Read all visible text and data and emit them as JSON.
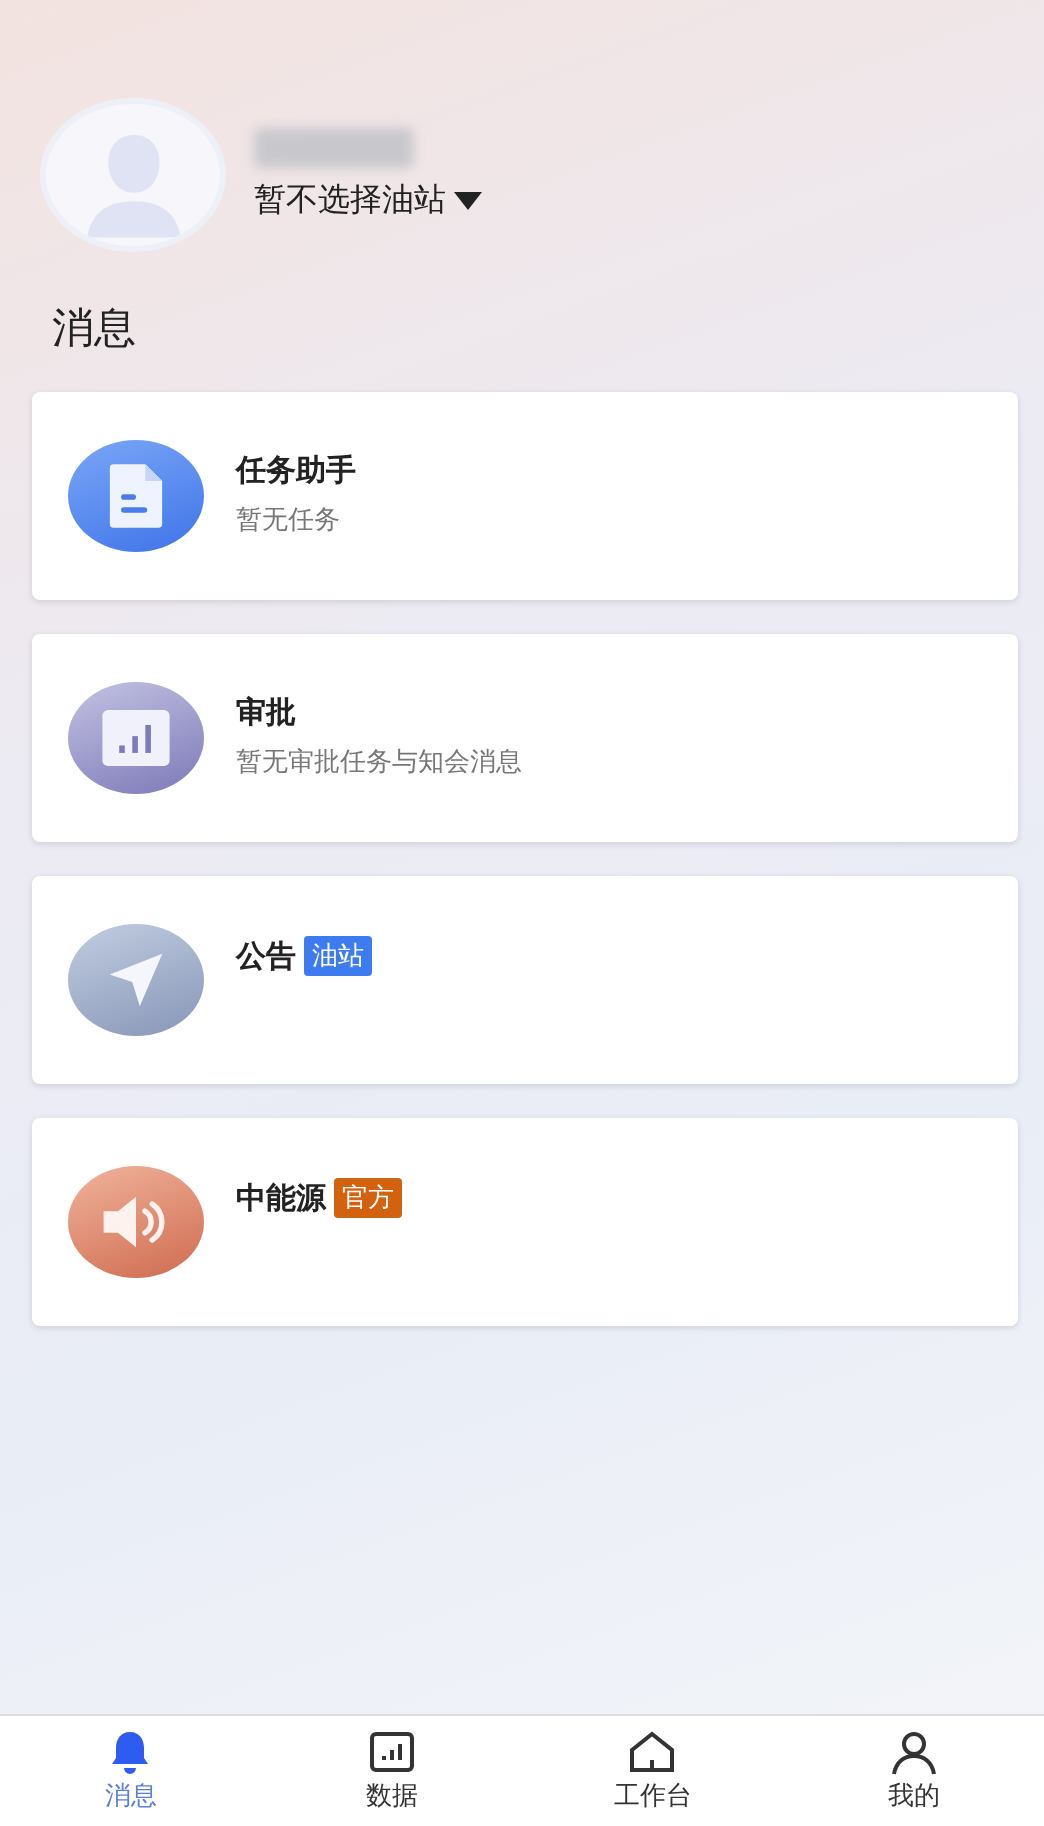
{
  "profile": {
    "station_picker": "暂不选择油站"
  },
  "section_title": "消息",
  "messages": [
    {
      "kind": "document",
      "title": "任务助手",
      "subtitle": "暂无任务"
    },
    {
      "kind": "chart",
      "title": "审批",
      "subtitle": "暂无审批任务与知会消息"
    },
    {
      "kind": "send",
      "title": "公告",
      "tag": {
        "text": "油站",
        "color": "#3d7bf0"
      }
    },
    {
      "kind": "speaker",
      "title": "中能源",
      "tag": {
        "text": "官方",
        "color": "#d2620e"
      }
    }
  ],
  "tabs": [
    {
      "kind": "bell",
      "label": "消息",
      "selected": true
    },
    {
      "kind": "chart",
      "label": "数据",
      "selected": false
    },
    {
      "kind": "home",
      "label": "工作台",
      "selected": false
    },
    {
      "kind": "person",
      "label": "我的",
      "selected": false
    }
  ]
}
